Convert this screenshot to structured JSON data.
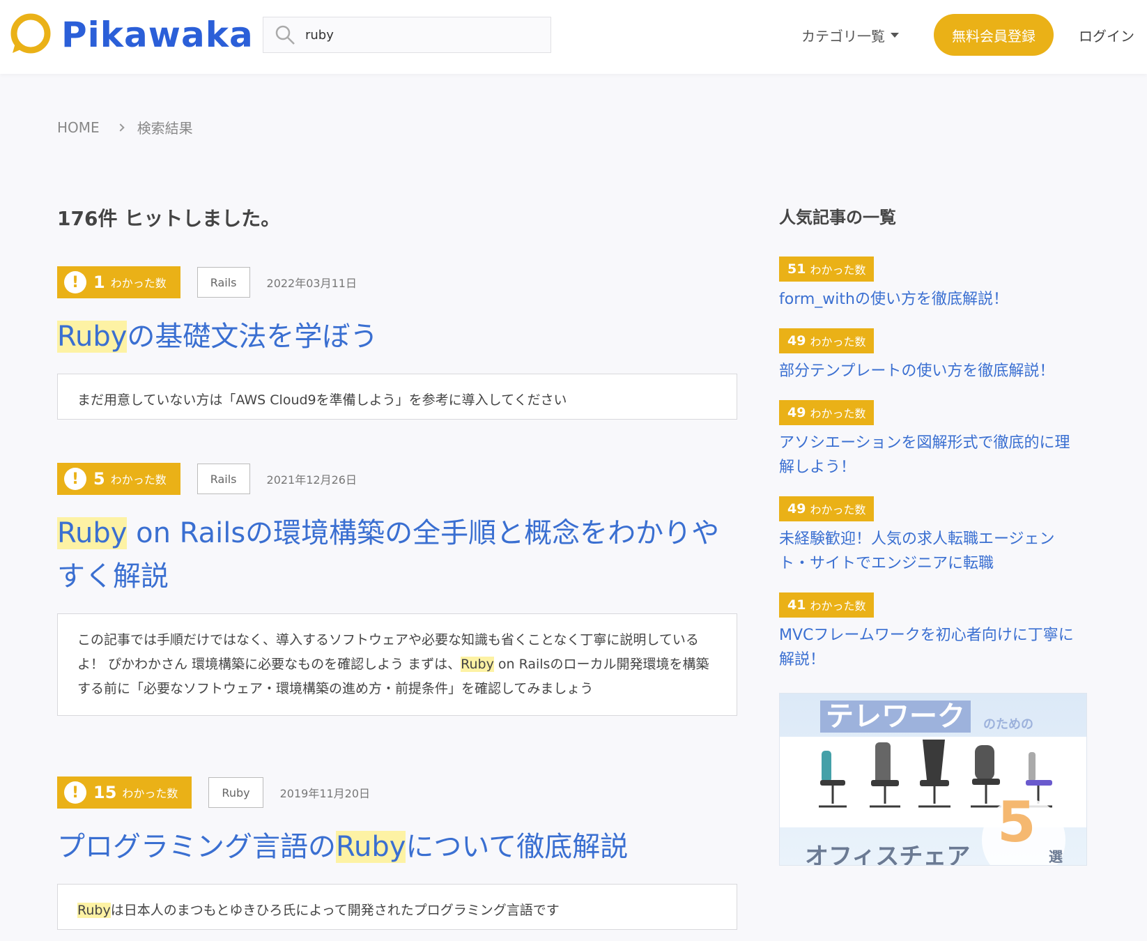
{
  "header": {
    "logo_text": "Pikawaka",
    "search_value": "ruby",
    "category_label": "カテゴリ一覧",
    "register_label": "無料会員登録",
    "login_label": "ログイン"
  },
  "breadcrumb": {
    "home": "HOME",
    "current": "検索結果"
  },
  "hits_label": "176件 ヒットしました。",
  "results": [
    {
      "count": "1",
      "count_label": "わかった数",
      "tag": "Rails",
      "date": "2022年03月11日",
      "title_hl": "Ruby",
      "title_rest": "の基礎文法を学ぼう",
      "excerpt": "まだ用意していない方は「AWS Cloud9を準備しよう」を参考に導入してください"
    },
    {
      "count": "5",
      "count_label": "わかった数",
      "tag": "Rails",
      "date": "2021年12月26日",
      "title_hl": "Ruby",
      "title_rest": " on Railsの環境構築の全手順と概念をわかりやすく解説",
      "excerpt_pre": "この記事では手順だけではなく、導入するソフトウェアや必要な知識も省くことなく丁寧に説明しているよ！ ぴかわかさん 環境構築に必要なものを確認しよう まずは、",
      "excerpt_hl": "Ruby",
      "excerpt_post": " on Railsのローカル開発環境を構築する前に「必要なソフトウェア・環境構築の進め方・前提条件」を確認してみましょう"
    },
    {
      "count": "15",
      "count_label": "わかった数",
      "tag": "Ruby",
      "date": "2019年11月20日",
      "title_pre": "プログラミング言語の",
      "title_hl": "Ruby",
      "title_rest": "について徹底解説",
      "excerpt_hl": "Ruby",
      "excerpt_post": "は日本人のまつもとゆきひろ氏によって開発されたプログラミング言語です"
    }
  ],
  "sidebar": {
    "heading": "人気記事の一覧",
    "items": [
      {
        "count": "51",
        "label": "わかった数",
        "title": "form_withの使い方を徹底解説！"
      },
      {
        "count": "49",
        "label": "わかった数",
        "title": "部分テンプレートの使い方を徹底解説！"
      },
      {
        "count": "49",
        "label": "わかった数",
        "title": "アソシエーションを図解形式で徹底的に理解しよう！"
      },
      {
        "count": "49",
        "label": "わかった数",
        "title": "未経験歓迎！人気の求人転職エージェント・サイトでエンジニアに転職"
      },
      {
        "count": "41",
        "label": "わかった数",
        "title": "MVCフレームワークを初心者向けに丁寧に解説！"
      }
    ],
    "banner": {
      "top": "テレワーク",
      "sub": "のための",
      "bottom": "オフィスチェア",
      "number": "5",
      "suffix": "選"
    }
  },
  "colors": {
    "accent": "#eab117",
    "link": "#3a6fd1",
    "brand": "#2b5fd8",
    "highlight": "#fdf2a4"
  }
}
